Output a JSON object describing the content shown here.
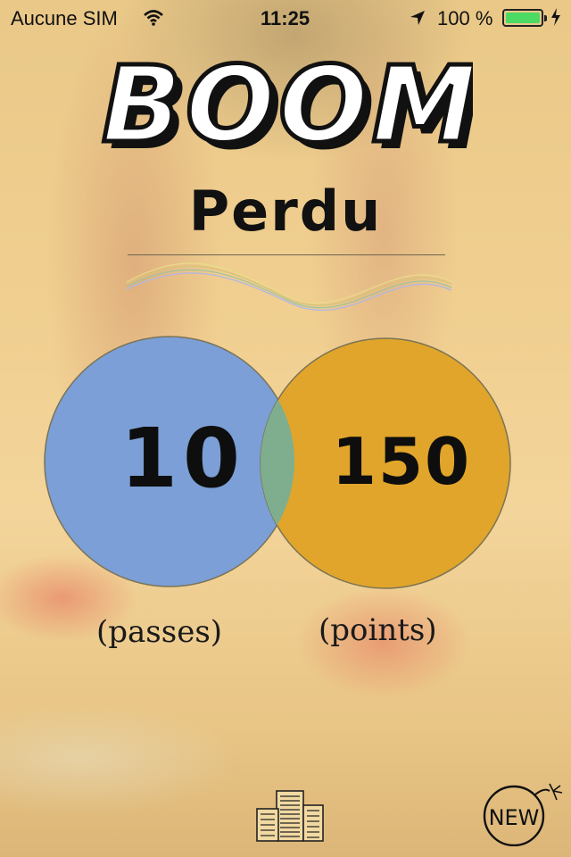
{
  "status_bar": {
    "carrier": "Aucune SIM",
    "time": "11:25",
    "battery_percent": "100 %",
    "battery_level": 1.0,
    "icons": [
      "wifi-icon",
      "location-arrow-icon",
      "battery-icon",
      "charging-bolt-icon"
    ]
  },
  "logo": {
    "text": "BOOM"
  },
  "result": {
    "title": "Perdu"
  },
  "stats": {
    "passes": {
      "value": "10",
      "label": "(passes)",
      "color": "#7b9fd6"
    },
    "points": {
      "value": "150",
      "label": "(points)",
      "color": "#e0a52a"
    },
    "overlap_color": "#7fae8e"
  },
  "footer": {
    "leaderboard_icon": "building-stack-icon",
    "new_button_label": "NEW",
    "new_button_icon": "bomb-icon"
  },
  "colors": {
    "background": "#efcf90",
    "text": "#111111",
    "battery": "#4cd964"
  }
}
